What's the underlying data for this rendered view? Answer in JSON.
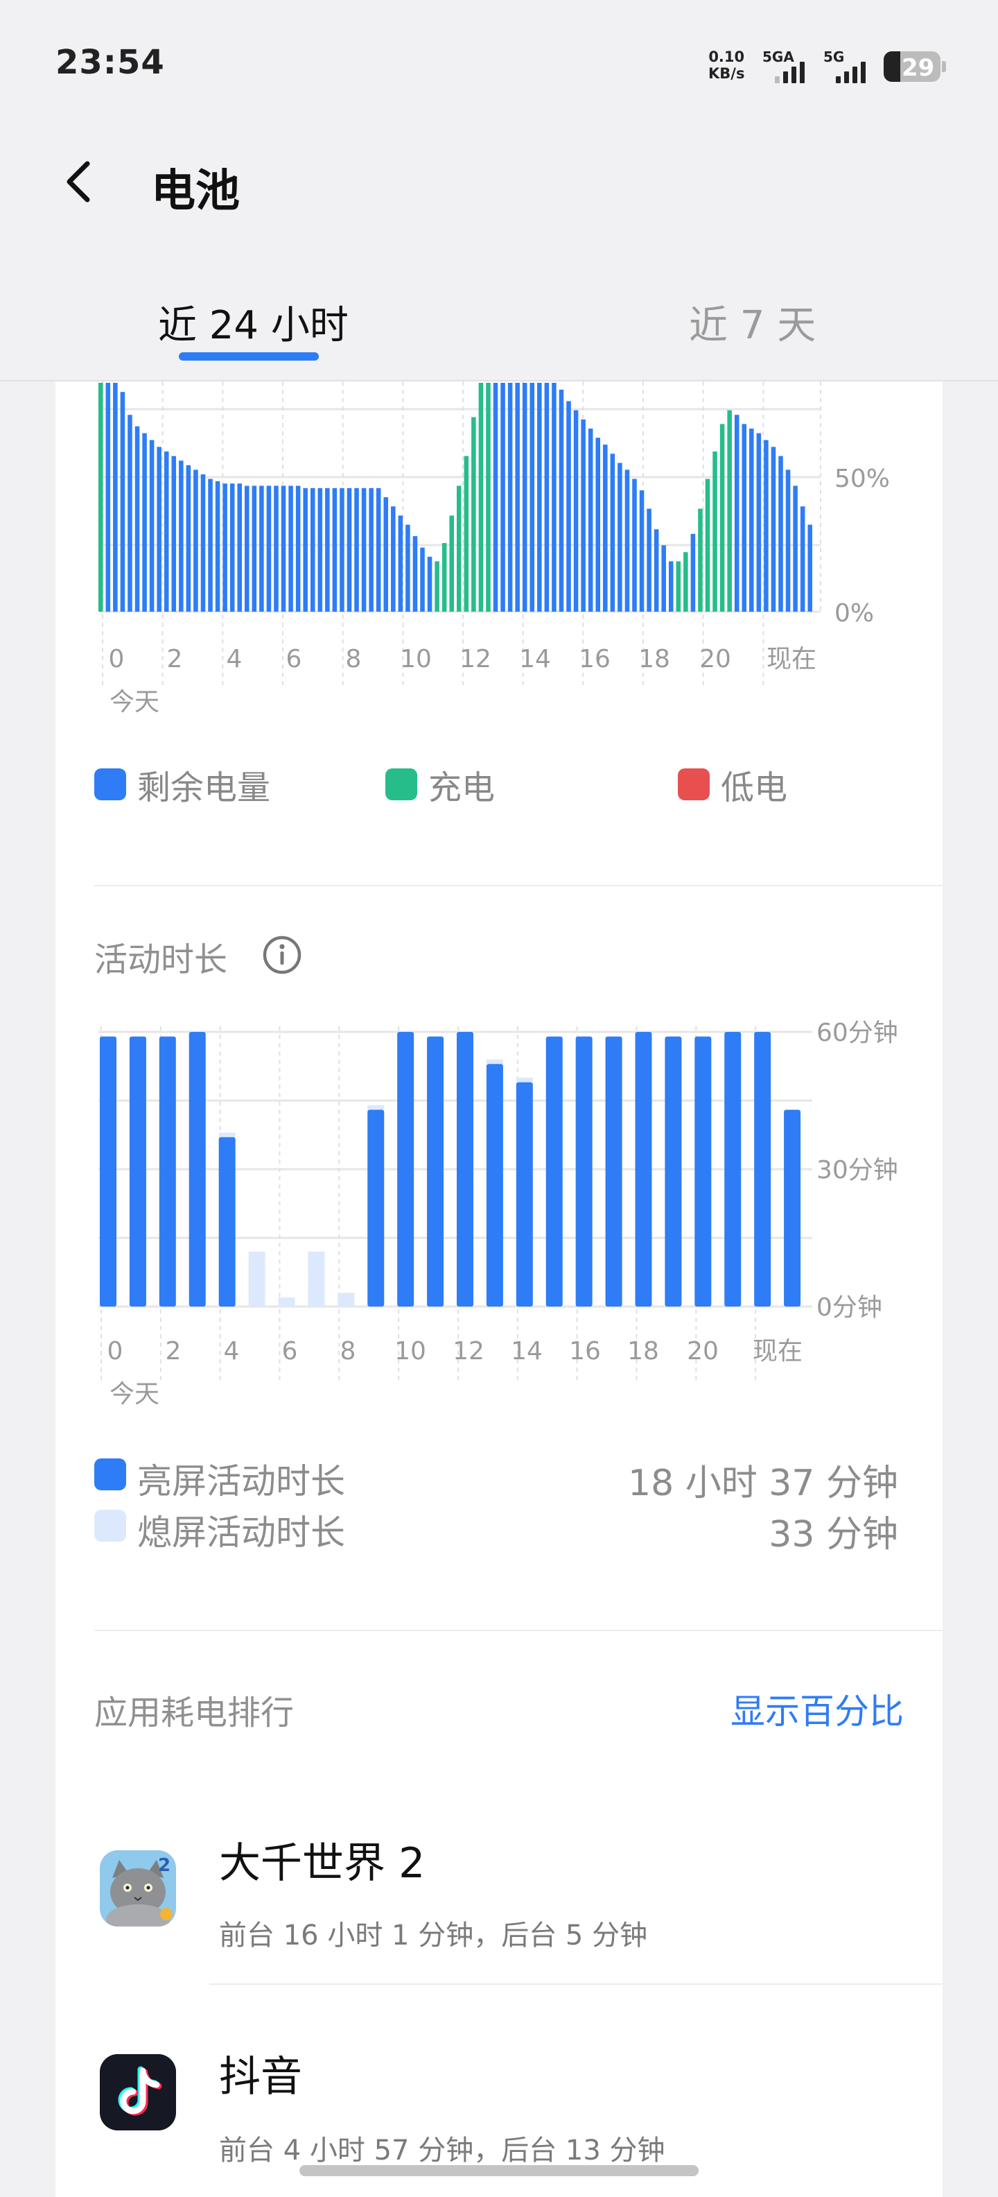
{
  "status_bar": {
    "time": "23:54",
    "net_speed_value": "0.10",
    "net_speed_unit": "KB/s",
    "signal1_label": "5GA",
    "signal2_label": "5G",
    "battery_level": "29"
  },
  "header": {
    "title": "电池"
  },
  "tabs": [
    {
      "label": "近 24 小时"
    },
    {
      "label": "近 7 天"
    }
  ],
  "battery_chart": {
    "type": "bar",
    "y_ticks": [
      "50%",
      "0%"
    ],
    "x_ticks": [
      "0",
      "2",
      "4",
      "6",
      "8",
      "10",
      "12",
      "14",
      "16",
      "18",
      "20",
      "现在"
    ],
    "date_label": "今天",
    "colors": {
      "remaining": "#2e7cf6",
      "charging": "#26bd8a",
      "low": "#e8504f"
    },
    "bars": [
      {
        "v": 100,
        "c": "charging"
      },
      {
        "v": 100,
        "c": "remaining"
      },
      {
        "v": 100,
        "c": "remaining"
      },
      {
        "v": 96,
        "c": "remaining"
      },
      {
        "v": 86,
        "c": "remaining"
      },
      {
        "v": 81,
        "c": "remaining"
      },
      {
        "v": 78,
        "c": "remaining"
      },
      {
        "v": 75,
        "c": "remaining"
      },
      {
        "v": 72,
        "c": "remaining"
      },
      {
        "v": 70,
        "c": "remaining"
      },
      {
        "v": 68,
        "c": "remaining"
      },
      {
        "v": 66,
        "c": "remaining"
      },
      {
        "v": 64,
        "c": "remaining"
      },
      {
        "v": 62,
        "c": "remaining"
      },
      {
        "v": 60,
        "c": "remaining"
      },
      {
        "v": 58,
        "c": "remaining"
      },
      {
        "v": 57,
        "c": "remaining"
      },
      {
        "v": 56,
        "c": "remaining"
      },
      {
        "v": 56,
        "c": "remaining"
      },
      {
        "v": 56,
        "c": "remaining"
      },
      {
        "v": 55,
        "c": "remaining"
      },
      {
        "v": 55,
        "c": "remaining"
      },
      {
        "v": 55,
        "c": "remaining"
      },
      {
        "v": 55,
        "c": "remaining"
      },
      {
        "v": 55,
        "c": "remaining"
      },
      {
        "v": 55,
        "c": "remaining"
      },
      {
        "v": 55,
        "c": "remaining"
      },
      {
        "v": 55,
        "c": "remaining"
      },
      {
        "v": 54,
        "c": "remaining"
      },
      {
        "v": 54,
        "c": "remaining"
      },
      {
        "v": 54,
        "c": "remaining"
      },
      {
        "v": 54,
        "c": "remaining"
      },
      {
        "v": 54,
        "c": "remaining"
      },
      {
        "v": 54,
        "c": "remaining"
      },
      {
        "v": 54,
        "c": "remaining"
      },
      {
        "v": 54,
        "c": "remaining"
      },
      {
        "v": 54,
        "c": "remaining"
      },
      {
        "v": 54,
        "c": "remaining"
      },
      {
        "v": 54,
        "c": "remaining"
      },
      {
        "v": 50,
        "c": "remaining"
      },
      {
        "v": 46,
        "c": "remaining"
      },
      {
        "v": 42,
        "c": "remaining"
      },
      {
        "v": 38,
        "c": "remaining"
      },
      {
        "v": 33,
        "c": "remaining"
      },
      {
        "v": 28,
        "c": "remaining"
      },
      {
        "v": 24,
        "c": "remaining"
      },
      {
        "v": 22,
        "c": "charging"
      },
      {
        "v": 30,
        "c": "charging"
      },
      {
        "v": 42,
        "c": "charging"
      },
      {
        "v": 55,
        "c": "charging"
      },
      {
        "v": 68,
        "c": "charging"
      },
      {
        "v": 85,
        "c": "charging"
      },
      {
        "v": 100,
        "c": "charging"
      },
      {
        "v": 100,
        "c": "charging"
      },
      {
        "v": 100,
        "c": "remaining"
      },
      {
        "v": 100,
        "c": "remaining"
      },
      {
        "v": 100,
        "c": "remaining"
      },
      {
        "v": 100,
        "c": "remaining"
      },
      {
        "v": 100,
        "c": "remaining"
      },
      {
        "v": 100,
        "c": "remaining"
      },
      {
        "v": 100,
        "c": "remaining"
      },
      {
        "v": 100,
        "c": "remaining"
      },
      {
        "v": 100,
        "c": "remaining"
      },
      {
        "v": 97,
        "c": "remaining"
      },
      {
        "v": 92,
        "c": "remaining"
      },
      {
        "v": 88,
        "c": "remaining"
      },
      {
        "v": 84,
        "c": "remaining"
      },
      {
        "v": 80,
        "c": "remaining"
      },
      {
        "v": 76,
        "c": "remaining"
      },
      {
        "v": 73,
        "c": "remaining"
      },
      {
        "v": 69,
        "c": "remaining"
      },
      {
        "v": 65,
        "c": "remaining"
      },
      {
        "v": 62,
        "c": "remaining"
      },
      {
        "v": 58,
        "c": "remaining"
      },
      {
        "v": 53,
        "c": "remaining"
      },
      {
        "v": 45,
        "c": "remaining"
      },
      {
        "v": 36,
        "c": "remaining"
      },
      {
        "v": 29,
        "c": "remaining"
      },
      {
        "v": 22,
        "c": "remaining"
      },
      {
        "v": 22,
        "c": "charging"
      },
      {
        "v": 26,
        "c": "charging"
      },
      {
        "v": 34,
        "c": "remaining"
      },
      {
        "v": 45,
        "c": "charging"
      },
      {
        "v": 58,
        "c": "charging"
      },
      {
        "v": 70,
        "c": "charging"
      },
      {
        "v": 82,
        "c": "charging"
      },
      {
        "v": 88,
        "c": "charging"
      },
      {
        "v": 86,
        "c": "remaining"
      },
      {
        "v": 82,
        "c": "remaining"
      },
      {
        "v": 80,
        "c": "remaining"
      },
      {
        "v": 78,
        "c": "remaining"
      },
      {
        "v": 75,
        "c": "remaining"
      },
      {
        "v": 72,
        "c": "remaining"
      },
      {
        "v": 68,
        "c": "remaining"
      },
      {
        "v": 62,
        "c": "remaining"
      },
      {
        "v": 55,
        "c": "remaining"
      },
      {
        "v": 46,
        "c": "remaining"
      },
      {
        "v": 38,
        "c": "remaining"
      }
    ]
  },
  "battery_legend": {
    "remaining": "剩余电量",
    "charging": "充电",
    "low": "低电"
  },
  "activity": {
    "title": "活动时长",
    "chart_data": {
      "type": "bar",
      "y_ticks": [
        "60分钟",
        "30分钟",
        "0分钟"
      ],
      "ylim": [
        0,
        60
      ],
      "x_ticks": [
        "0",
        "2",
        "4",
        "6",
        "8",
        "10",
        "12",
        "14",
        "16",
        "18",
        "20",
        "现在"
      ],
      "date_label": "今天",
      "series": [
        {
          "name": "亮屏活动时长",
          "color": "#2e7cf6",
          "values": [
            59,
            59,
            59,
            60,
            37,
            0,
            0,
            0,
            0,
            43,
            60,
            59,
            60,
            53,
            49,
            59,
            59,
            59,
            60,
            59,
            59,
            60,
            60,
            43
          ]
        },
        {
          "name": "熄屏活动时长",
          "color": "#dce9fd",
          "values": [
            0,
            0,
            0,
            0,
            1,
            12,
            2,
            12,
            3,
            1,
            0,
            0,
            0,
            1,
            1,
            0,
            0,
            0,
            0,
            0,
            0,
            0,
            0,
            0
          ]
        }
      ]
    },
    "screen_on_label": "亮屏活动时长",
    "screen_on_value": "18 小时 37 分钟",
    "screen_off_label": "熄屏活动时长",
    "screen_off_value": "33 分钟"
  },
  "ranking": {
    "title": "应用耗电排行",
    "toggle_label": "显示百分比",
    "apps": [
      {
        "name": "大千世界 2",
        "detail": "前台 16 小时 1 分钟，后台 5 分钟",
        "icon": "cat-game-icon"
      },
      {
        "name": "抖音",
        "detail": "前台 4 小时 57 分钟，后台 13 分钟",
        "icon": "douyin-icon"
      }
    ]
  }
}
